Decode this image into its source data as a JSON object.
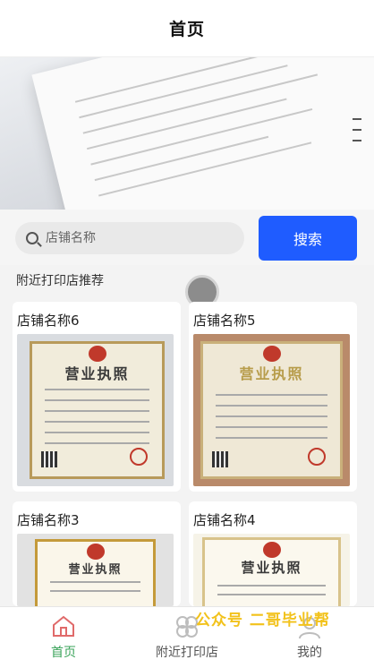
{
  "header": {
    "title": "首页"
  },
  "search": {
    "placeholder": "店铺名称",
    "button_label": "搜索"
  },
  "section": {
    "title": "附近打印店推荐"
  },
  "shops": [
    {
      "name": "店铺名称6",
      "license_title": "营业执照"
    },
    {
      "name": "店铺名称5",
      "license_title": "营业执照"
    },
    {
      "name": "店铺名称3",
      "license_title": "营业执照"
    },
    {
      "name": "店铺名称4",
      "license_title": "营业执照"
    }
  ],
  "watermark": "公众号 二哥毕业帮",
  "tabs": [
    {
      "label": "首页",
      "icon": "home-icon",
      "active": true
    },
    {
      "label": "附近打印店",
      "icon": "store-icon",
      "active": false
    },
    {
      "label": "我的",
      "icon": "user-icon",
      "active": false
    }
  ],
  "colors": {
    "accent": "#1f5cff",
    "tab_active": "#3aa35a",
    "tab_inactive": "#555555",
    "watermark": "#f2c21b"
  }
}
